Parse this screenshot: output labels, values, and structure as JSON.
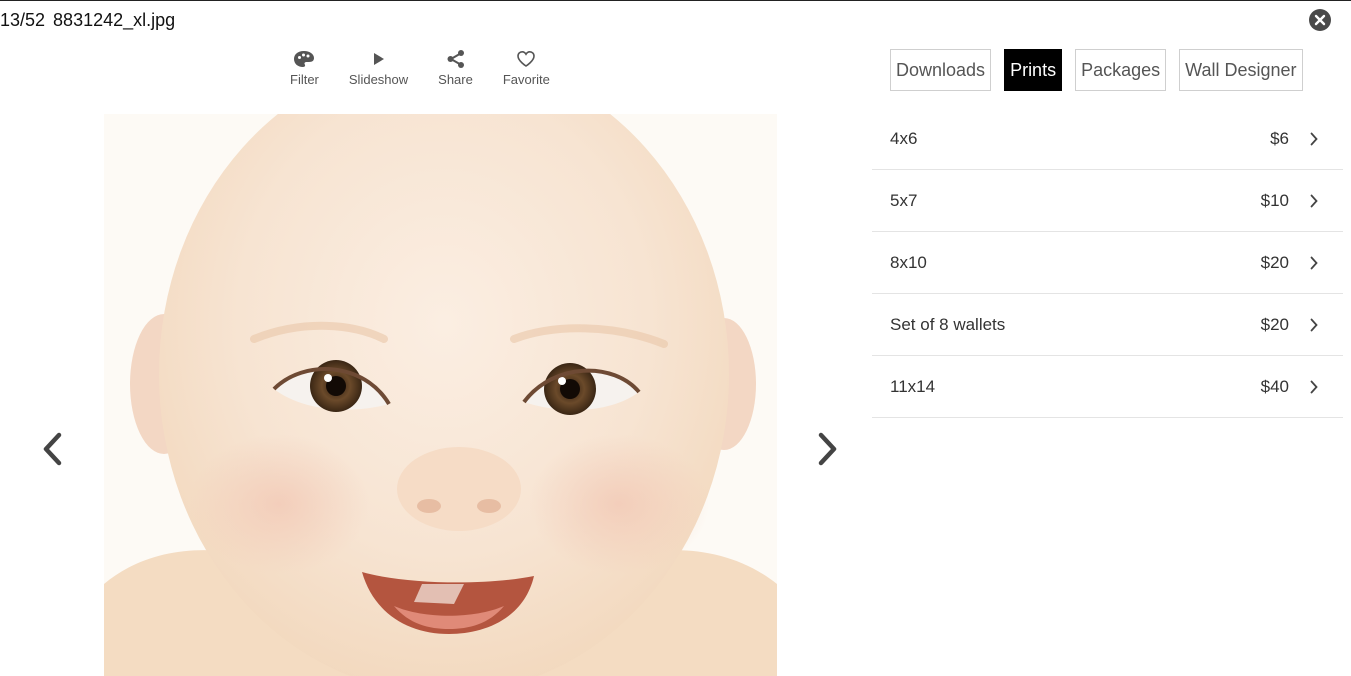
{
  "header": {
    "counter": "13/52",
    "filename": "8831242_xl.jpg"
  },
  "toolbar": {
    "items": [
      {
        "label": "Filter",
        "icon": "palette-icon"
      },
      {
        "label": "Slideshow",
        "icon": "play-icon"
      },
      {
        "label": "Share",
        "icon": "share-icon"
      },
      {
        "label": "Favorite",
        "icon": "heart-icon"
      }
    ]
  },
  "tabs": {
    "items": [
      {
        "label": "Downloads",
        "active": false
      },
      {
        "label": "Prints",
        "active": true
      },
      {
        "label": "Packages",
        "active": false
      },
      {
        "label": "Wall Designer",
        "active": false
      }
    ]
  },
  "prices": {
    "items": [
      {
        "name": "4x6",
        "price": "$6"
      },
      {
        "name": "5x7",
        "price": "$10"
      },
      {
        "name": "8x10",
        "price": "$20"
      },
      {
        "name": "Set of 8 wallets",
        "price": "$20"
      },
      {
        "name": "11x14",
        "price": "$40"
      }
    ]
  },
  "colors": {
    "active_tab_bg": "#000000",
    "active_tab_text": "#ffffff",
    "icon": "#555555"
  }
}
